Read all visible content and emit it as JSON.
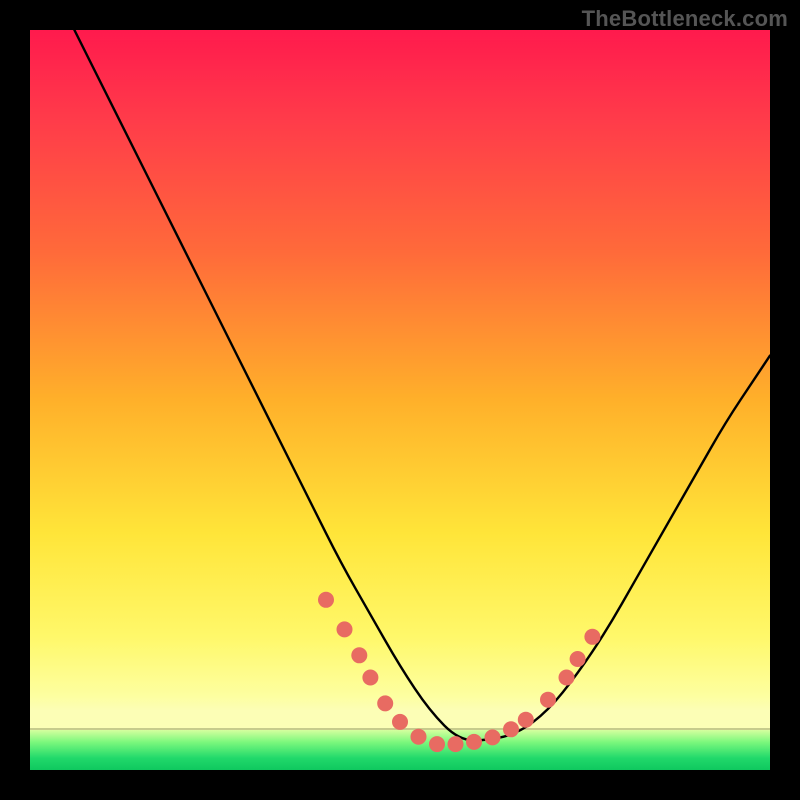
{
  "watermark": "TheBottleneck.com",
  "colors": {
    "curve": "#000000",
    "marker": "#e86b62",
    "background_black": "#000000"
  },
  "chart_data": {
    "type": "line",
    "title": "",
    "xlabel": "",
    "ylabel": "",
    "xlim": [
      0,
      100
    ],
    "ylim": [
      0,
      100
    ],
    "note": "No axis ticks or numeric labels are visible; values are estimated from pixel positions within the 740×740 plot area, expressed as 0–100 with (0,0) at bottom-left.",
    "series": [
      {
        "name": "bottleneck-curve",
        "type": "line",
        "x": [
          6,
          10,
          14,
          18,
          22,
          26,
          30,
          34,
          38,
          42,
          46,
          50,
          54,
          58,
          62,
          66,
          70,
          74,
          78,
          82,
          86,
          90,
          94,
          98,
          100
        ],
        "y": [
          100,
          92,
          84,
          76,
          68,
          60,
          52,
          44,
          36,
          28,
          21,
          14,
          8,
          4,
          4,
          5,
          8,
          13,
          19,
          26,
          33,
          40,
          47,
          53,
          56
        ]
      },
      {
        "name": "gradient-boundary-green",
        "type": "area",
        "y_threshold": 5.4
      }
    ],
    "markers": {
      "name": "highlighted-points",
      "color": "#e86b62",
      "radius_px": 8,
      "points_xy": [
        [
          40,
          23
        ],
        [
          42.5,
          19
        ],
        [
          44.5,
          15.5
        ],
        [
          46,
          12.5
        ],
        [
          48,
          9
        ],
        [
          50,
          6.5
        ],
        [
          52.5,
          4.5
        ],
        [
          55,
          3.5
        ],
        [
          57.5,
          3.5
        ],
        [
          60,
          3.8
        ],
        [
          62.5,
          4.4
        ],
        [
          65,
          5.5
        ],
        [
          67,
          6.8
        ],
        [
          70,
          9.5
        ],
        [
          72.5,
          12.5
        ],
        [
          74,
          15
        ],
        [
          76,
          18
        ]
      ]
    }
  }
}
